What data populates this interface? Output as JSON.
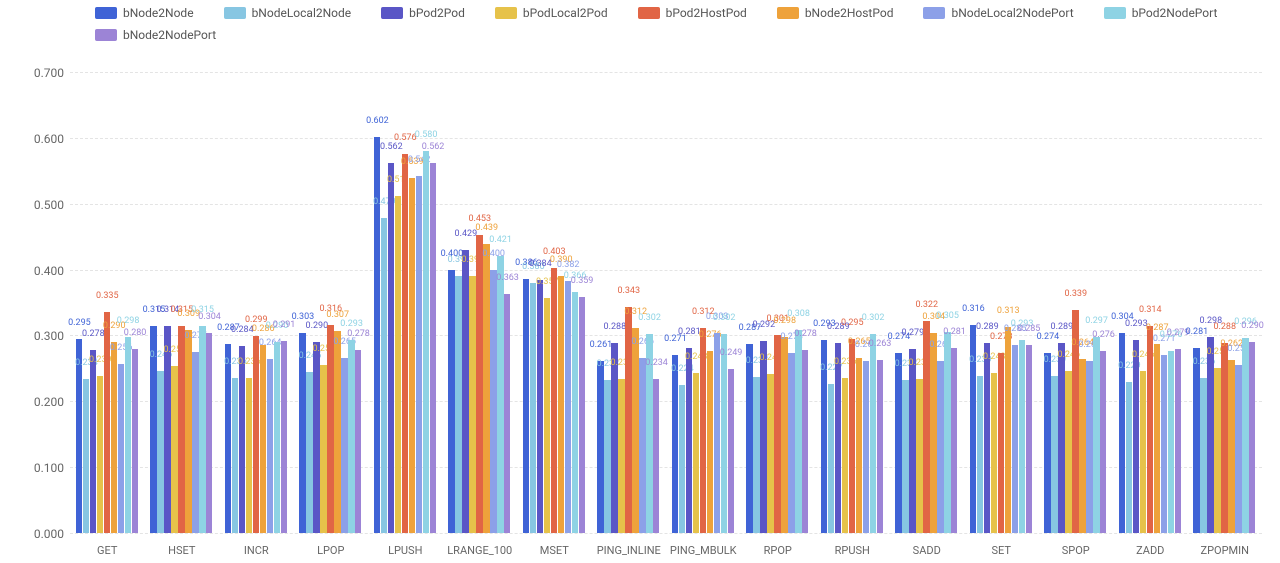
{
  "chart_data": {
    "type": "bar",
    "ylim": [
      0,
      0.7
    ],
    "yticks": [
      0.0,
      0.1,
      0.2,
      0.3,
      0.4,
      0.5,
      0.6,
      0.7
    ],
    "title": "",
    "xlabel": "",
    "ylabel": "",
    "categories": [
      "GET",
      "HSET",
      "INCR",
      "LPOP",
      "LPUSH",
      "LRANGE_100",
      "MSET",
      "PING_INLINE",
      "PING_MBULK",
      "RPOP",
      "RPUSH",
      "SADD",
      "SET",
      "SPOP",
      "ZADD",
      "ZPOPMIN"
    ],
    "series": [
      {
        "name": "bNode2Node",
        "color": "#3f63d6",
        "values": [
          0.295,
          0.315,
          0.287,
          0.303,
          0.602,
          0.4,
          0.386,
          0.261,
          0.271,
          0.287,
          0.293,
          0.274,
          0.316,
          0.274,
          0.304,
          0.281
        ]
      },
      {
        "name": "bNodeLocal2Node",
        "color": "#87c6e2",
        "values": [
          0.234,
          0.246,
          0.236,
          0.245,
          0.479,
          0.391,
          0.38,
          0.233,
          0.224,
          0.237,
          0.227,
          0.233,
          0.239,
          0.239,
          0.229,
          0.236
        ]
      },
      {
        "name": "bPod2Pod",
        "color": "#5a56c6",
        "values": [
          0.278,
          0.314,
          0.284,
          0.29,
          0.562,
          0.429,
          0.384,
          0.288,
          0.281,
          0.292,
          0.289,
          0.279,
          0.289,
          0.289,
          0.293,
          0.298
        ]
      },
      {
        "name": "bPodLocal2Pod",
        "color": "#e6c24a",
        "values": [
          0.239,
          0.253,
          0.236,
          0.255,
          0.511,
          0.391,
          0.357,
          0.234,
          0.243,
          0.241,
          0.236,
          0.234,
          0.243,
          0.246,
          0.246,
          0.251
        ]
      },
      {
        "name": "bPod2HostPod",
        "color": "#e16545",
        "values": [
          0.335,
          0.315,
          0.299,
          0.316,
          0.576,
          0.453,
          0.403,
          0.343,
          0.312,
          0.301,
          0.295,
          0.322,
          0.273,
          0.339,
          0.314,
          0.288
        ]
      },
      {
        "name": "bNode2HostPod",
        "color": "#eea23b",
        "values": [
          0.29,
          0.309,
          0.286,
          0.307,
          0.539,
          0.439,
          0.39,
          0.312,
          0.276,
          0.298,
          0.265,
          0.304,
          0.313,
          0.264,
          0.287,
          0.262
        ]
      },
      {
        "name": "bNodeLocal2NodePort",
        "color": "#8ca0e8",
        "values": [
          0.256,
          0.275,
          0.264,
          0.265,
          0.542,
          0.4,
          0.382,
          0.266,
          0.303,
          0.273,
          0.261,
          0.261,
          0.285,
          0.261,
          0.271,
          0.255
        ]
      },
      {
        "name": "bPod2NodePort",
        "color": "#8ed3e4",
        "values": [
          0.298,
          0.315,
          0.29,
          0.293,
          0.58,
          0.421,
          0.366,
          0.302,
          0.302,
          0.308,
          0.302,
          0.305,
          0.293,
          0.297,
          0.276,
          0.296
        ]
      },
      {
        "name": "bNode2NodePort",
        "color": "#9c84d6",
        "values": [
          0.28,
          0.304,
          0.291,
          0.278,
          0.562,
          0.363,
          0.359,
          0.234,
          0.249,
          0.278,
          0.263,
          0.281,
          0.285,
          0.276,
          0.279,
          0.29
        ]
      }
    ]
  },
  "legend_items": [
    {
      "label": "bNode2Node",
      "color": "#3f63d6"
    },
    {
      "label": "bNodeLocal2Node",
      "color": "#87c6e2"
    },
    {
      "label": "bPod2Pod",
      "color": "#5a56c6"
    },
    {
      "label": "bPodLocal2Pod",
      "color": "#e6c24a"
    },
    {
      "label": "bPod2HostPod",
      "color": "#e16545"
    },
    {
      "label": "bNode2HostPod",
      "color": "#eea23b"
    },
    {
      "label": "bNodeLocal2NodePort",
      "color": "#8ca0e8"
    },
    {
      "label": "bPod2NodePort",
      "color": "#8ed3e4"
    },
    {
      "label": "bNode2NodePort",
      "color": "#9c84d6"
    }
  ]
}
